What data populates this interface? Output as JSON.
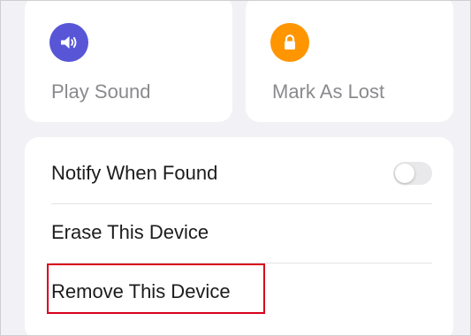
{
  "actions": {
    "play_sound": {
      "label": "Play Sound",
      "icon": "speaker-icon",
      "color": "#5856d6"
    },
    "mark_as_lost": {
      "label": "Mark As Lost",
      "icon": "lock-icon",
      "color": "#ff9500"
    }
  },
  "settings": {
    "notify_when_found": {
      "label": "Notify When Found",
      "enabled": false
    },
    "erase_device": {
      "label": "Erase This Device"
    },
    "remove_device": {
      "label": "Remove This Device",
      "highlighted": true,
      "highlight_color": "#d9001b"
    }
  }
}
